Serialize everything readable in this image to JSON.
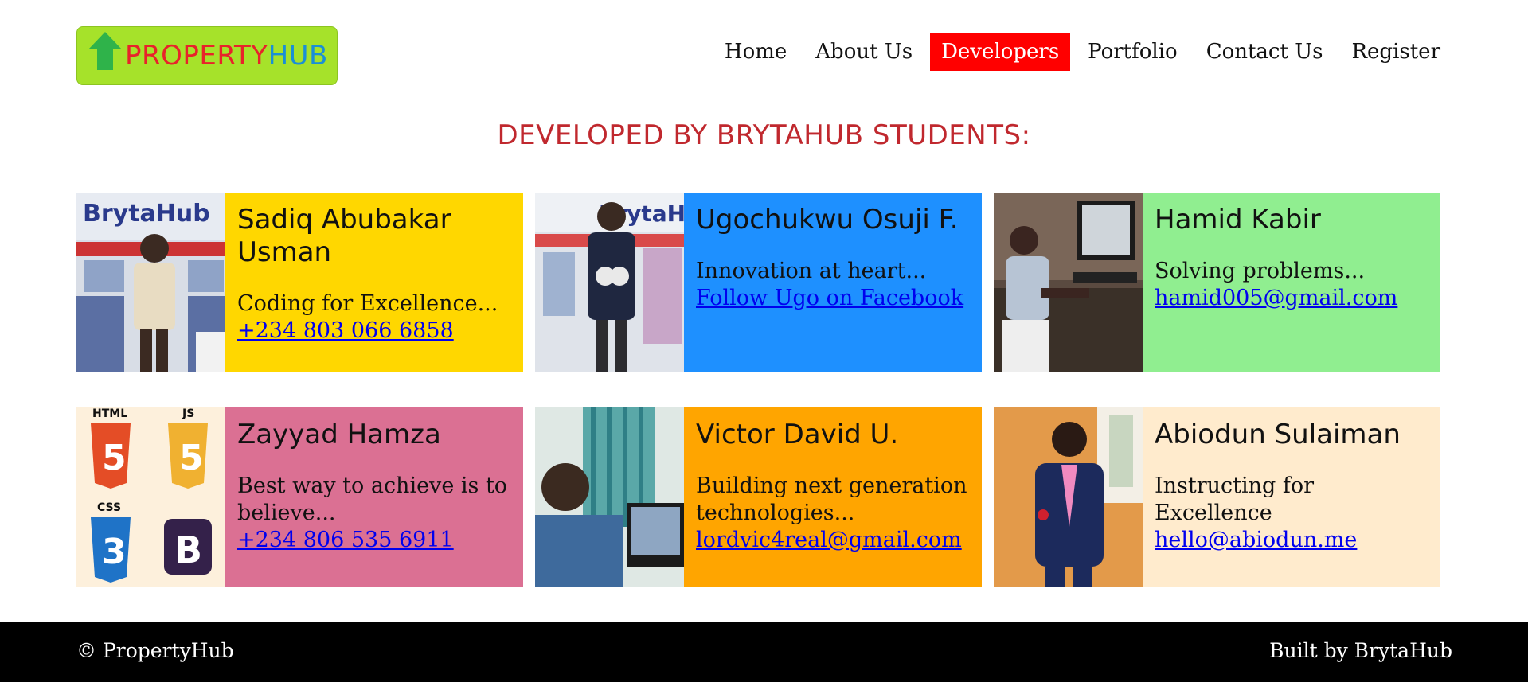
{
  "logo": {
    "part1": "PROPERTY",
    "part2": "HUB"
  },
  "nav": {
    "items": [
      {
        "label": "Home",
        "active": false
      },
      {
        "label": "About Us",
        "active": false
      },
      {
        "label": "Developers",
        "active": true
      },
      {
        "label": "Portfolio",
        "active": false
      },
      {
        "label": "Contact Us",
        "active": false
      },
      {
        "label": "Register",
        "active": false
      }
    ]
  },
  "main": {
    "title": "DEVELOPED BY BRYTAHUB STUDENTS:"
  },
  "developers": [
    {
      "name": "Sadiq Abubakar Usman",
      "tagline": "Coding for Excellence...",
      "contact": "+234 803 066 6858",
      "color": "#ffd700"
    },
    {
      "name": "Ugochukwu Osuji F.",
      "tagline": "Innovation at heart...",
      "contact": "Follow Ugo on Facebook",
      "color": "#1e90ff"
    },
    {
      "name": "Hamid Kabir",
      "tagline": "Solving problems...",
      "contact": "hamid005@gmail.com",
      "color": "#90ee90"
    },
    {
      "name": "Zayyad Hamza",
      "tagline": "Best way to achieve is to believe...",
      "contact": "+234 806 535 6911",
      "color": "#db7093"
    },
    {
      "name": "Victor David U.",
      "tagline": "Building next generation technologies...",
      "contact": "lordvic4real@gmail.com",
      "color": "#ffa500"
    },
    {
      "name": "Abiodun Sulaiman",
      "tagline": "Instructing for Excellence",
      "contact": "hello@abiodun.me",
      "color": "#ffebcd"
    }
  ],
  "tech_logos": {
    "html": "HTML",
    "js": "JS",
    "css": "CSS",
    "bootstrap": "B"
  },
  "photo_signs": {
    "brytahub": "BrytaHub"
  },
  "footer": {
    "left": "© PropertyHub",
    "right": "Built by BrytaHub"
  }
}
